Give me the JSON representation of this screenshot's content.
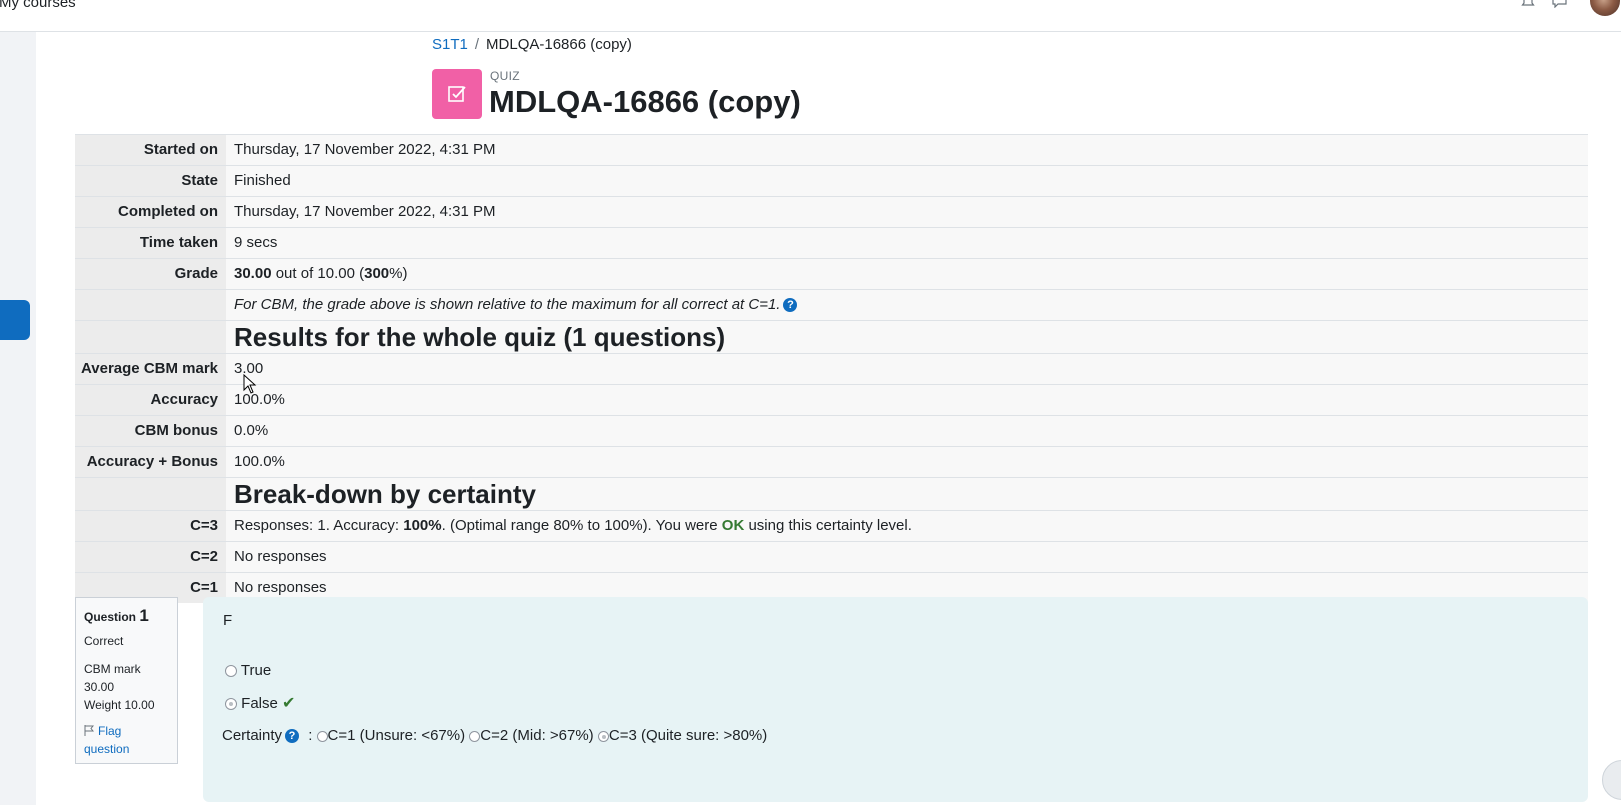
{
  "navbar": {
    "my_courses": "My courses"
  },
  "breadcrumb": {
    "course": "S1T1",
    "current": "MDLQA-16866 (copy)"
  },
  "activity": {
    "type_label": "QUIZ",
    "title": "MDLQA-16866 (copy)"
  },
  "summary": {
    "rows": [
      {
        "label": "Started on",
        "value": "Thursday, 17 November 2022, 4:31 PM"
      },
      {
        "label": "State",
        "value": "Finished"
      },
      {
        "label": "Completed on",
        "value": "Thursday, 17 November 2022, 4:31 PM"
      },
      {
        "label": "Time taken",
        "value": "9 secs"
      }
    ],
    "grade": {
      "label": "Grade",
      "score": "30.00",
      "mid": " out of 10.00 (",
      "percent": "300",
      "end": "%)"
    },
    "cbm_note": "For CBM, the grade above is shown relative to the maximum for all correct at C=1.",
    "results_heading": "Results for the whole quiz (1 questions)",
    "results_rows": [
      {
        "label": "Average CBM mark",
        "value": "3.00"
      },
      {
        "label": "Accuracy",
        "value": "100.0%"
      },
      {
        "label": "CBM bonus",
        "value": "0.0%"
      },
      {
        "label": "Accuracy + Bonus",
        "value": "100.0%"
      }
    ],
    "breakdown_heading": "Break-down by certainty",
    "c3": {
      "label": "C=3",
      "part1": "Responses: 1. Accuracy: ",
      "accuracy": "100%",
      "part2": ". (Optimal range 80% to 100%). You were ",
      "ok": "OK",
      "part3": " using this certainty level."
    },
    "c2": {
      "label": "C=2",
      "value": "No responses"
    },
    "c1": {
      "label": "C=1",
      "value": "No responses"
    }
  },
  "question": {
    "label": "Question",
    "number": "1",
    "status": "Correct",
    "cbm_mark_label": "CBM mark",
    "cbm_mark": "30.00",
    "weight": "Weight 10.00",
    "flag": "Flag question",
    "text": "F",
    "options": [
      {
        "label": "True",
        "checked": false
      },
      {
        "label": "False",
        "checked": true
      }
    ],
    "certainty_label": "Certainty",
    "certainty_options": [
      "C=1 (Unsure: <67%)",
      "C=2 (Mid: >67%)",
      "C=3 (Quite sure: >80%)"
    ]
  }
}
